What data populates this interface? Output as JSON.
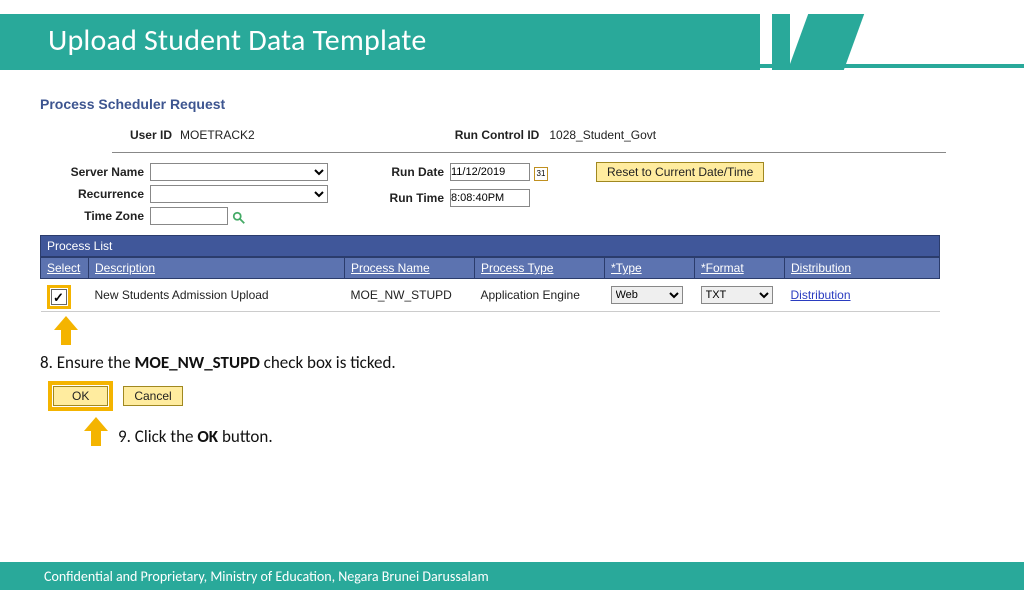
{
  "header": {
    "title": "Upload Student Data Template"
  },
  "ps_title": "Process Scheduler Request",
  "info": {
    "user_id_lbl": "User ID",
    "user_id": "MOETRACK2",
    "run_control_lbl": "Run Control ID",
    "run_control": "1028_Student_Govt"
  },
  "form": {
    "server_name_lbl": "Server Name",
    "server_name": "",
    "recurrence_lbl": "Recurrence",
    "recurrence": "",
    "time_zone_lbl": "Time Zone",
    "time_zone": "",
    "run_date_lbl": "Run Date",
    "run_date": "11/12/2019",
    "run_time_lbl": "Run Time",
    "run_time": "8:08:40PM",
    "reset_btn": "Reset to Current Date/Time"
  },
  "grid": {
    "title": "Process List",
    "cols": {
      "select": "Select",
      "description": "Description",
      "process_name": "Process Name",
      "process_type": "Process Type",
      "type": "*Type",
      "format": "*Format",
      "distribution": "Distribution"
    },
    "row": {
      "checked": true,
      "description": "New Students Admission Upload",
      "process_name": "MOE_NW_STUPD",
      "process_type": "Application Engine",
      "type": "Web",
      "format": "TXT",
      "distribution": "Distribution"
    }
  },
  "steps": {
    "s8_pre": "8. Ensure the ",
    "s8_bold": "MOE_NW_STUPD",
    "s8_post": " check box is ticked.",
    "s9_pre": "9. Click the ",
    "s9_bold": "OK",
    "s9_post": " button."
  },
  "buttons": {
    "ok": "OK",
    "cancel": "Cancel"
  },
  "footer": "Confidential and Proprietary, Ministry of Education, Negara Brunei Darussalam",
  "icons": {
    "magnifier": "search-icon",
    "calendar": "31"
  }
}
